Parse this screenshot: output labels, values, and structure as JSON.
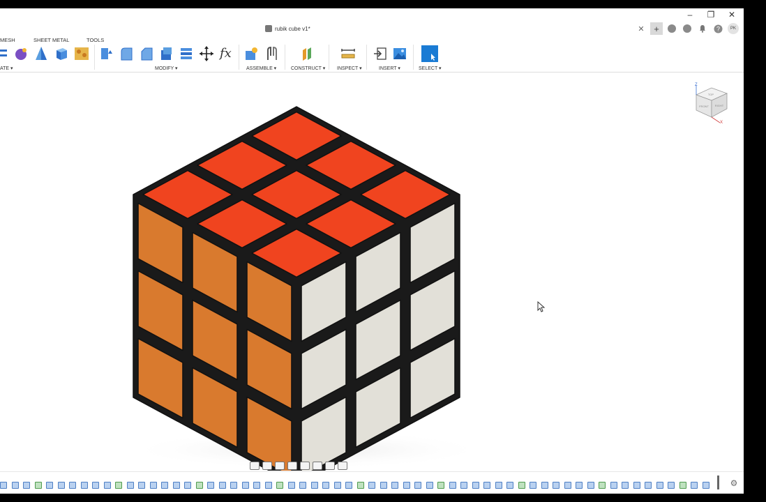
{
  "window": {
    "minimize_glyph": "–",
    "restore_glyph": "❐",
    "close_glyph": "✕"
  },
  "tabs": {
    "document_title": "rubik cube v1*",
    "close_glyph": "✕",
    "icons": [
      "add-tab-icon",
      "extensions-icon",
      "job-status-icon",
      "notifications-icon",
      "help-icon"
    ],
    "user_initials": "PK"
  },
  "workspace_tabs": [
    "MESH",
    "SHEET METAL",
    "TOOLS"
  ],
  "toolbar_groups": {
    "create": "ATE ▾",
    "modify": "MODIFY ▾",
    "assemble": "ASSEMBLE ▾",
    "construct": "CONSTRUCT ▾",
    "inspect": "INSPECT ▾",
    "insert": "INSERT ▾",
    "select": "SELECT ▾"
  },
  "modify_fx_label": "fx",
  "viewcube_axes": {
    "z": "Z",
    "x": "X"
  },
  "viewcube_faces": {
    "top": "TOP",
    "front": "FRONT",
    "right": "RIGHT"
  },
  "colors": {
    "top_face": "#f0441f",
    "left_face": "#d97a2e",
    "right_face": "#e2e0d8",
    "cube_body": "#1a1a1a",
    "accent": "#1a7bd4"
  },
  "timeline": {
    "feature_count": 62
  },
  "navbar": {
    "icons": [
      "orbit-icon",
      "look-at-icon",
      "pan-icon",
      "zoom-window-icon",
      "fit-icon",
      "display-settings-icon",
      "grid-icon",
      "viewports-icon"
    ]
  }
}
